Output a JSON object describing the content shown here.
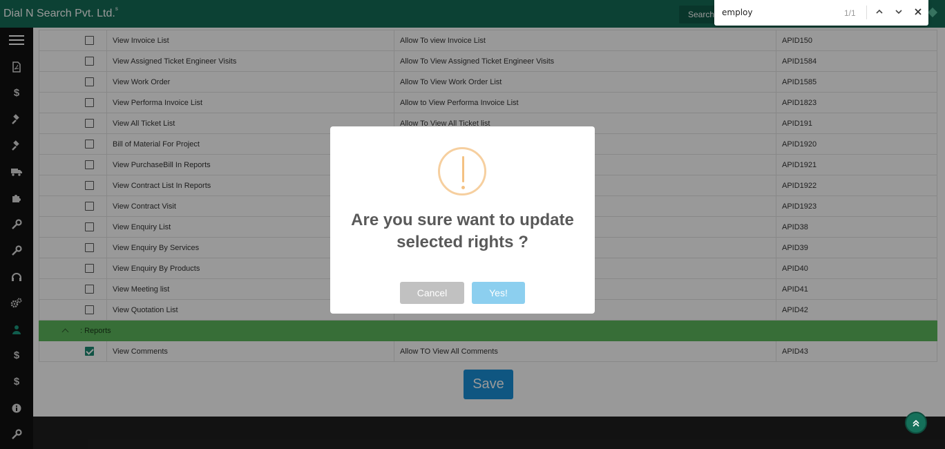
{
  "header": {
    "brand": "Dial N Search Pvt. Ltd.",
    "brand_sup": "s",
    "search_label": "Search."
  },
  "findbar": {
    "query": "employ",
    "count": "1/1"
  },
  "sidebar": {
    "icons": [
      "menu-icon",
      "pdf-icon",
      "dollar-icon",
      "gavel-icon",
      "gavel-icon",
      "truck-icon",
      "puzzle-icon",
      "wrench-icon",
      "wrench-icon",
      "headphones-icon",
      "gears-icon",
      "user-icon",
      "dollar-icon",
      "dollar-icon",
      "info-icon",
      "wrench-icon"
    ],
    "active_color": "#1b9b80"
  },
  "table": {
    "rows": [
      {
        "name": "View Invoice List",
        "desc": "Allow To view Invoice List",
        "code": "APID150",
        "checked": false
      },
      {
        "name": "View Assigned Ticket Engineer Visits",
        "desc": "Allow To View Assigned Ticket Engineer Visits",
        "code": "APID1584",
        "checked": false
      },
      {
        "name": "View Work Order",
        "desc": "Allow To View Work Order List",
        "code": "APID1585",
        "checked": false
      },
      {
        "name": "View Performa Invoice List",
        "desc": "Allow to View Performa Invoice List",
        "code": "APID1823",
        "checked": false
      },
      {
        "name": "View All Ticket List",
        "desc": "Allow To View All Ticket list",
        "code": "APID191",
        "checked": false
      },
      {
        "name": "Bill of Material For Project",
        "desc": "",
        "code": "APID1920",
        "checked": false
      },
      {
        "name": "View PurchaseBill In Reports",
        "desc": "",
        "code": "APID1921",
        "checked": false
      },
      {
        "name": "View Contract List In Reports",
        "desc": "",
        "code": "APID1922",
        "checked": false
      },
      {
        "name": "View Contract Visit",
        "desc": "",
        "code": "APID1923",
        "checked": false
      },
      {
        "name": "View Enquiry List",
        "desc": "",
        "code": "APID38",
        "checked": false
      },
      {
        "name": "View Enquiry By Services",
        "desc": "",
        "code": "APID39",
        "checked": false
      },
      {
        "name": "View Enquiry By Products",
        "desc": "",
        "code": "APID40",
        "checked": false
      },
      {
        "name": "View Meeting list",
        "desc": "",
        "code": "APID41",
        "checked": false
      },
      {
        "name": "View Quotation List",
        "desc": "",
        "code": "APID42",
        "checked": false
      }
    ],
    "group_label": ": Reports",
    "group_color": "#5cb85c",
    "group_rows": [
      {
        "name": "View Comments",
        "desc": "Allow TO View All Comments",
        "code": "APID43",
        "checked": true
      }
    ]
  },
  "save_label": "Save",
  "dialog": {
    "title": "Are you sure want to update selected rights ?",
    "cancel_label": "Cancel",
    "confirm_label": "Yes!",
    "icon": "warning-icon",
    "icon_color": "#f4c182"
  }
}
